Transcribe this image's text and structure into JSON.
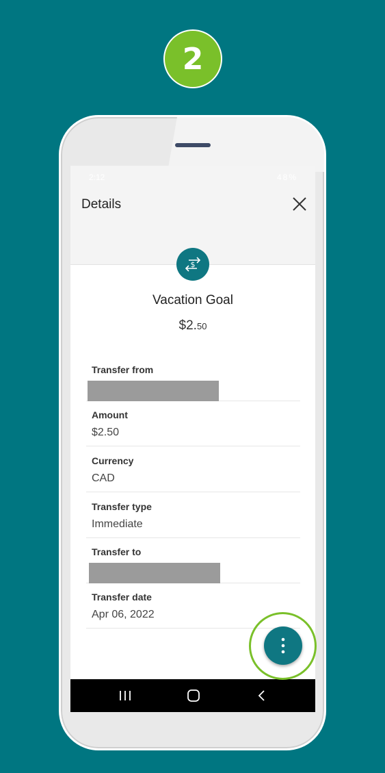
{
  "step": {
    "number": "2"
  },
  "statusbar": {
    "time": "2:12",
    "battery": "48%"
  },
  "details": {
    "title": "Details",
    "goal_name": "Vacation Goal",
    "amount_main": "$2.",
    "amount_cents": "50",
    "fields": [
      {
        "label": "Transfer from",
        "value": ""
      },
      {
        "label": "Amount",
        "value": "$2.50"
      },
      {
        "label": "Currency",
        "value": "CAD"
      },
      {
        "label": "Transfer type",
        "value": "Immediate"
      },
      {
        "label": "Transfer to",
        "value": ""
      },
      {
        "label": "Transfer date",
        "value": "Apr 06, 2022"
      }
    ]
  },
  "icons": {
    "close": "close-icon",
    "transfer": "dollar-transfer-icon",
    "more": "more-vertical-icon",
    "recents": "recents-icon",
    "home": "home-icon",
    "back": "back-icon"
  },
  "colors": {
    "background": "#007681",
    "accent_green": "#7ac02a",
    "brand_teal": "#0f7782"
  }
}
